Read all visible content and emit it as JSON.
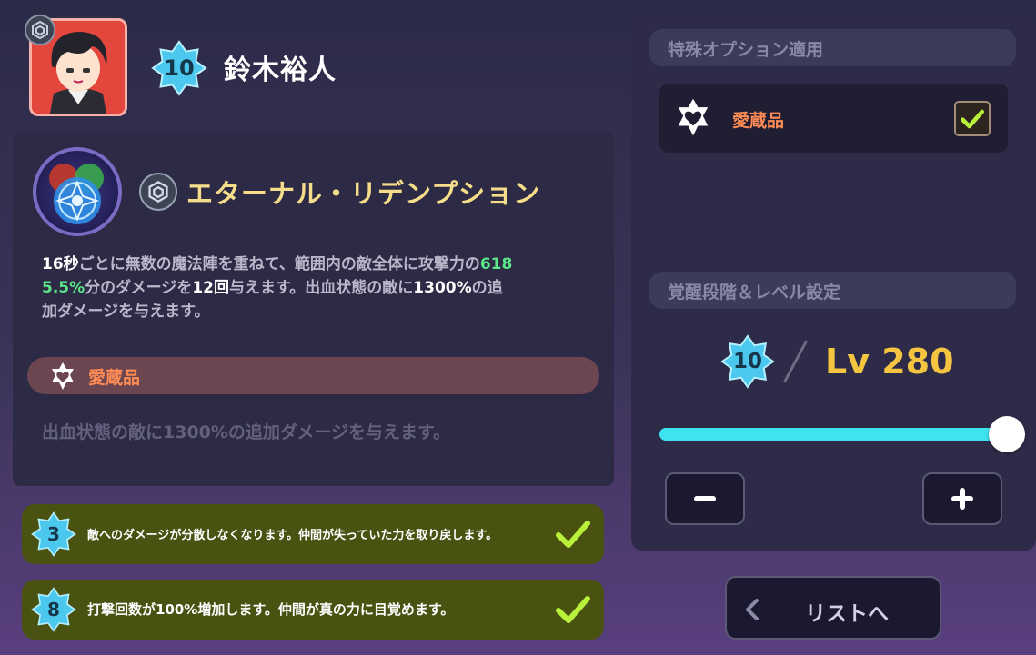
{
  "character": {
    "name": "鈴木裕人",
    "awakening": "10"
  },
  "skill": {
    "name": "エターナル・リデンプション",
    "desc": {
      "seg1": "16秒",
      "seg2": "ごとに無数の魔法陣を重ねて、範囲内の敵全体に攻撃力の",
      "seg3": "618",
      "seg4": "5.5%",
      "seg5": "分のダメージを",
      "seg6": "12回",
      "seg7": "与えます。出血状態の敵に",
      "seg8": "1300%",
      "seg9": "の追",
      "seg10": "加ダメージを与えます。"
    },
    "treasure_label": "愛蔵品",
    "treasure_desc": "出血状態の敵に1300%の追加ダメージを与えます。"
  },
  "awakening_effects": [
    {
      "level": "3",
      "text": "敵へのダメージが分散しなくなります。仲間が失っていた力を取り戻します。",
      "checked": true
    },
    {
      "level": "8",
      "text": "打撃回数が100%増加します。仲間が真の力に目覚めます。",
      "checked": true
    }
  ],
  "options": {
    "header": "特殊オプション適用",
    "treasure_label": "愛蔵品",
    "treasure_checked": true
  },
  "level_settings": {
    "header": "覚醒段階＆レベル設定",
    "awakening": "10",
    "level_text": "Lv 280",
    "slider_fraction": 1.0
  },
  "buttons": {
    "minus": "−",
    "plus": "+",
    "list": "リストへ"
  },
  "colors": {
    "accent_cyan": "#3fe3f0",
    "level_gold": "#f5c542",
    "treasure_orange": "#ff8b55",
    "check_green": "#b8f03a"
  }
}
